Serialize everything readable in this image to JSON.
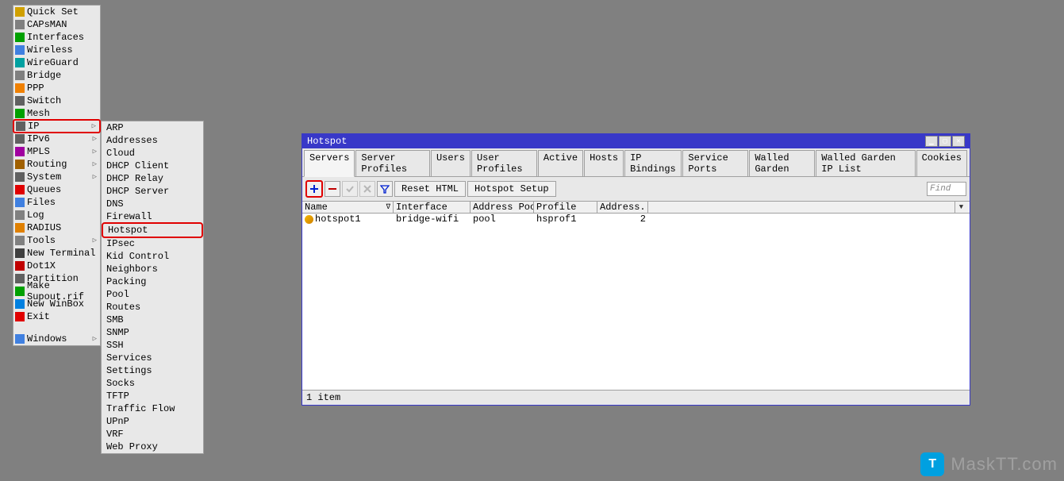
{
  "sidebar": {
    "items": [
      {
        "label": "Quick Set",
        "icon": "wand",
        "arrow": false
      },
      {
        "label": "CAPsMAN",
        "icon": "shield",
        "arrow": false
      },
      {
        "label": "Interfaces",
        "icon": "iface",
        "arrow": false
      },
      {
        "label": "Wireless",
        "icon": "wifi",
        "arrow": false
      },
      {
        "label": "WireGuard",
        "icon": "wg",
        "arrow": false
      },
      {
        "label": "Bridge",
        "icon": "bridge",
        "arrow": false
      },
      {
        "label": "PPP",
        "icon": "ppp",
        "arrow": false
      },
      {
        "label": "Switch",
        "icon": "switch",
        "arrow": false
      },
      {
        "label": "Mesh",
        "icon": "mesh",
        "arrow": false
      },
      {
        "label": "IP",
        "icon": "ip",
        "arrow": true,
        "hl": true
      },
      {
        "label": "IPv6",
        "icon": "ipv6",
        "arrow": true
      },
      {
        "label": "MPLS",
        "icon": "mpls",
        "arrow": true
      },
      {
        "label": "Routing",
        "icon": "route",
        "arrow": true
      },
      {
        "label": "System",
        "icon": "gear",
        "arrow": true
      },
      {
        "label": "Queues",
        "icon": "queue",
        "arrow": false
      },
      {
        "label": "Files",
        "icon": "folder",
        "arrow": false
      },
      {
        "label": "Log",
        "icon": "log",
        "arrow": false
      },
      {
        "label": "RADIUS",
        "icon": "radius",
        "arrow": false
      },
      {
        "label": "Tools",
        "icon": "tools",
        "arrow": true
      },
      {
        "label": "New Terminal",
        "icon": "term",
        "arrow": false
      },
      {
        "label": "Dot1X",
        "icon": "dot",
        "arrow": false
      },
      {
        "label": "Partition",
        "icon": "part",
        "arrow": false
      },
      {
        "label": "Make Supout.rif",
        "icon": "supout",
        "arrow": false
      },
      {
        "label": "New WinBox",
        "icon": "winbox",
        "arrow": false
      },
      {
        "label": "Exit",
        "icon": "exit",
        "arrow": false
      }
    ],
    "windows_label": "Windows"
  },
  "submenu": {
    "items": [
      "ARP",
      "Addresses",
      "Cloud",
      "DHCP Client",
      "DHCP Relay",
      "DHCP Server",
      "DNS",
      "Firewall",
      "Hotspot",
      "IPsec",
      "Kid Control",
      "Neighbors",
      "Packing",
      "Pool",
      "Routes",
      "SMB",
      "SNMP",
      "SSH",
      "Services",
      "Settings",
      "Socks",
      "TFTP",
      "Traffic Flow",
      "UPnP",
      "VRF",
      "Web Proxy"
    ],
    "hl_index": 8
  },
  "dialog": {
    "title": "Hotspot",
    "tabs": [
      "Servers",
      "Server Profiles",
      "Users",
      "User Profiles",
      "Active",
      "Hosts",
      "IP Bindings",
      "Service Ports",
      "Walled Garden",
      "Walled Garden IP List",
      "Cookies"
    ],
    "active_tab": 0,
    "toolbar": {
      "reset": "Reset HTML",
      "setup": "Hotspot Setup",
      "find": "Find"
    },
    "columns": [
      "Name",
      "Interface",
      "Address Pool",
      "Profile",
      "Address..."
    ],
    "sort_col": 0,
    "rows": [
      {
        "name": "hotspot1",
        "iface": "bridge-wifi",
        "pool": "pool",
        "profile": "hsprof1",
        "addr": "2"
      }
    ],
    "status": "1 item"
  },
  "watermark": {
    "text": "MaskTT.com",
    "badge": "T"
  },
  "colors": {
    "titlebar": "#3838c8",
    "highlight": "#e00000",
    "desktop": "#808080"
  }
}
